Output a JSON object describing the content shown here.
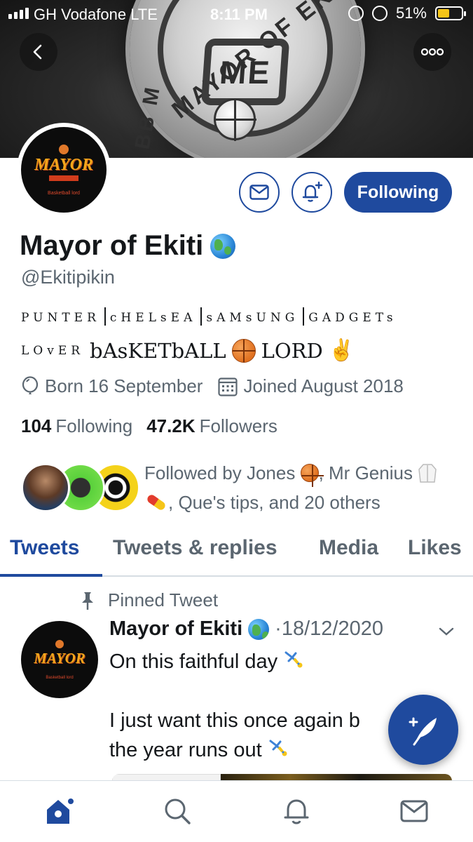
{
  "status_bar": {
    "carrier": "GH Vodafone  LTE",
    "time": "8:11 PM",
    "battery": "51%",
    "battery_level": 0.51
  },
  "banner": {
    "seal_top_text": "MAYOR OF EKITI",
    "seal_left_text": "BB M",
    "seal_monogram": "ME"
  },
  "profile": {
    "avatar_logo": "MAYOR",
    "avatar_sub": "Basketball lord",
    "display_name": "Mayor of Ekiti",
    "handle": "@Ekitipikin",
    "bio": {
      "part1": "PUNTER",
      "part2": "cHELsEA",
      "part3": "sAMsUNG",
      "part4": "GADGETs",
      "lover": "LOvER",
      "basketball": "bAsKETbALL",
      "lord": "LORD",
      "victory": "✌"
    },
    "birthday": "Born 16 September",
    "joined": "Joined August 2018",
    "following_count": "104",
    "following_label": "Following",
    "followers_count": "47.2K",
    "followers_label": "Followers",
    "followed_by_prefix": "Followed by Jones",
    "followed_by_mid": ", Mr Genius",
    "followed_by_suffix": ", Que's tips, and 20 others",
    "follow_button": "Following"
  },
  "tabs": [
    {
      "label": "Tweets",
      "active": true
    },
    {
      "label": "Tweets & replies",
      "active": false
    },
    {
      "label": "Media",
      "active": false
    },
    {
      "label": "Likes",
      "active": false
    }
  ],
  "pinned_tweet": {
    "pinned_label": "Pinned Tweet",
    "author": "Mayor of Ekiti",
    "date": "·18/12/2020",
    "line1": "On this faithful day",
    "line2": "I just want this once again b",
    "line3": "the year runs out"
  },
  "colors": {
    "accent": "#1f4a9e",
    "secondary_text": "#5b6670",
    "primary_text": "#14171a"
  },
  "icons": {
    "back": "chevron-left-icon",
    "more": "more-dots-icon",
    "message": "envelope-icon",
    "notify": "bell-plus-icon",
    "birthday": "balloon-icon",
    "joined": "calendar-icon",
    "pin": "pin-icon",
    "compose": "feather-plus-icon",
    "home": "home-icon",
    "search": "search-icon",
    "notifications": "bell-icon",
    "messages": "envelope-icon"
  }
}
